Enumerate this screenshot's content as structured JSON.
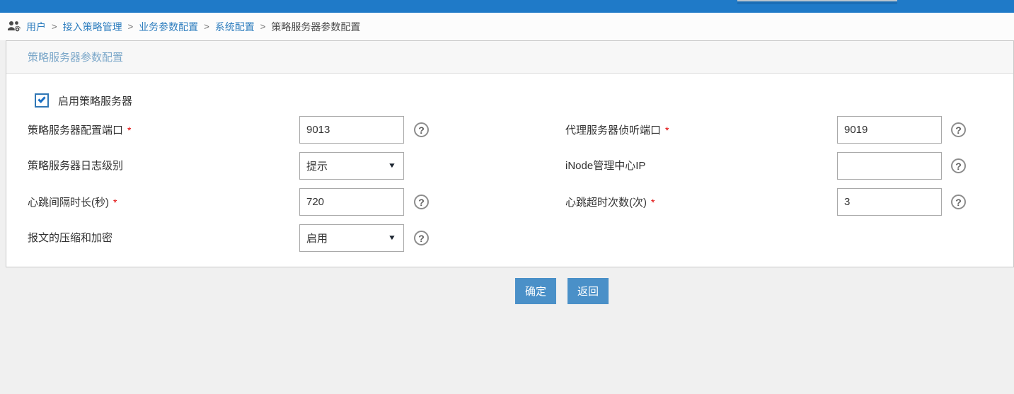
{
  "topbar": {
    "color": "#1f7ac8"
  },
  "breadcrumb": {
    "separator": ">",
    "items": [
      {
        "label": "用户"
      },
      {
        "label": "接入策略管理"
      },
      {
        "label": "业务参数配置"
      },
      {
        "label": "系统配置"
      },
      {
        "label": "策略服务器参数配置"
      }
    ]
  },
  "panel": {
    "title": "策略服务器参数配置"
  },
  "form": {
    "required_mark": "*",
    "enable_checkbox": {
      "label": "启用策略服务器",
      "checked": true
    },
    "fields": [
      {
        "label": "策略服务器配置端口",
        "required": true,
        "type": "input",
        "value": "9013",
        "help": true
      },
      {
        "label": "代理服务器侦听端口",
        "required": true,
        "type": "input",
        "value": "9019",
        "help": true
      },
      {
        "label": "策略服务器日志级别",
        "required": false,
        "type": "select",
        "value": "提示",
        "help": false
      },
      {
        "label": "iNode管理中心IP",
        "required": false,
        "type": "input",
        "value": "",
        "help": true
      },
      {
        "label": "心跳间隔时长(秒)",
        "required": true,
        "type": "input",
        "value": "720",
        "help": true
      },
      {
        "label": "心跳超时次数(次)",
        "required": true,
        "type": "input",
        "value": "3",
        "help": true
      },
      {
        "label": "报文的压缩和加密",
        "required": false,
        "type": "select",
        "value": "启用",
        "help": true
      }
    ]
  },
  "icons": {
    "help": "?",
    "caret": "▼"
  },
  "buttons": {
    "ok": "确定",
    "back": "返回"
  }
}
